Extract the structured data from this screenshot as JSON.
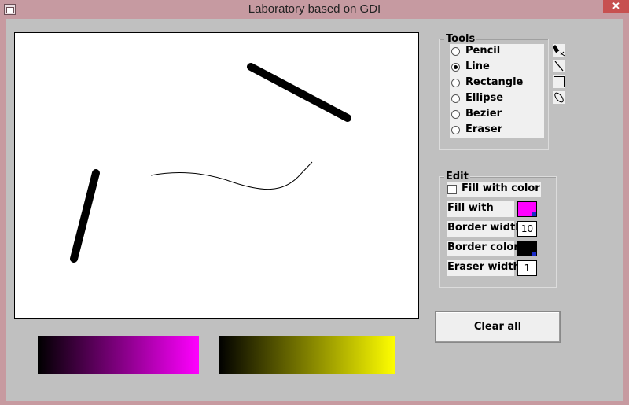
{
  "window": {
    "title": "Laboratory based on GDI",
    "close_glyph": "✕"
  },
  "tools": {
    "title": "Tools",
    "options": [
      {
        "label": "Pencil",
        "checked": false
      },
      {
        "label": "Line",
        "checked": true
      },
      {
        "label": "Rectangle",
        "checked": false
      },
      {
        "label": "Ellipse",
        "checked": false
      },
      {
        "label": "Bezier",
        "checked": false
      },
      {
        "label": "Eraser",
        "checked": false
      }
    ],
    "icons": [
      "pencil-icon",
      "line-icon",
      "rectangle-icon",
      "ellipse-icon"
    ]
  },
  "edit": {
    "title": "Edit",
    "fill_with_color_label": "Fill with color",
    "fill_with_color_checked": false,
    "fill_with_label": "Fill with",
    "fill_color": "#ff00ff",
    "border_width_label": "Border width",
    "border_width_value": "10",
    "border_color_label": "Border color",
    "border_color": "#000000",
    "eraser_width_label": "Eraser width",
    "eraser_width_value": "1"
  },
  "clear_all_label": "Clear all",
  "gradients": {
    "magenta": {
      "from": "#000000",
      "to": "#ff00ff"
    },
    "yellow": {
      "from": "#000000",
      "to": "#ffff00"
    }
  }
}
